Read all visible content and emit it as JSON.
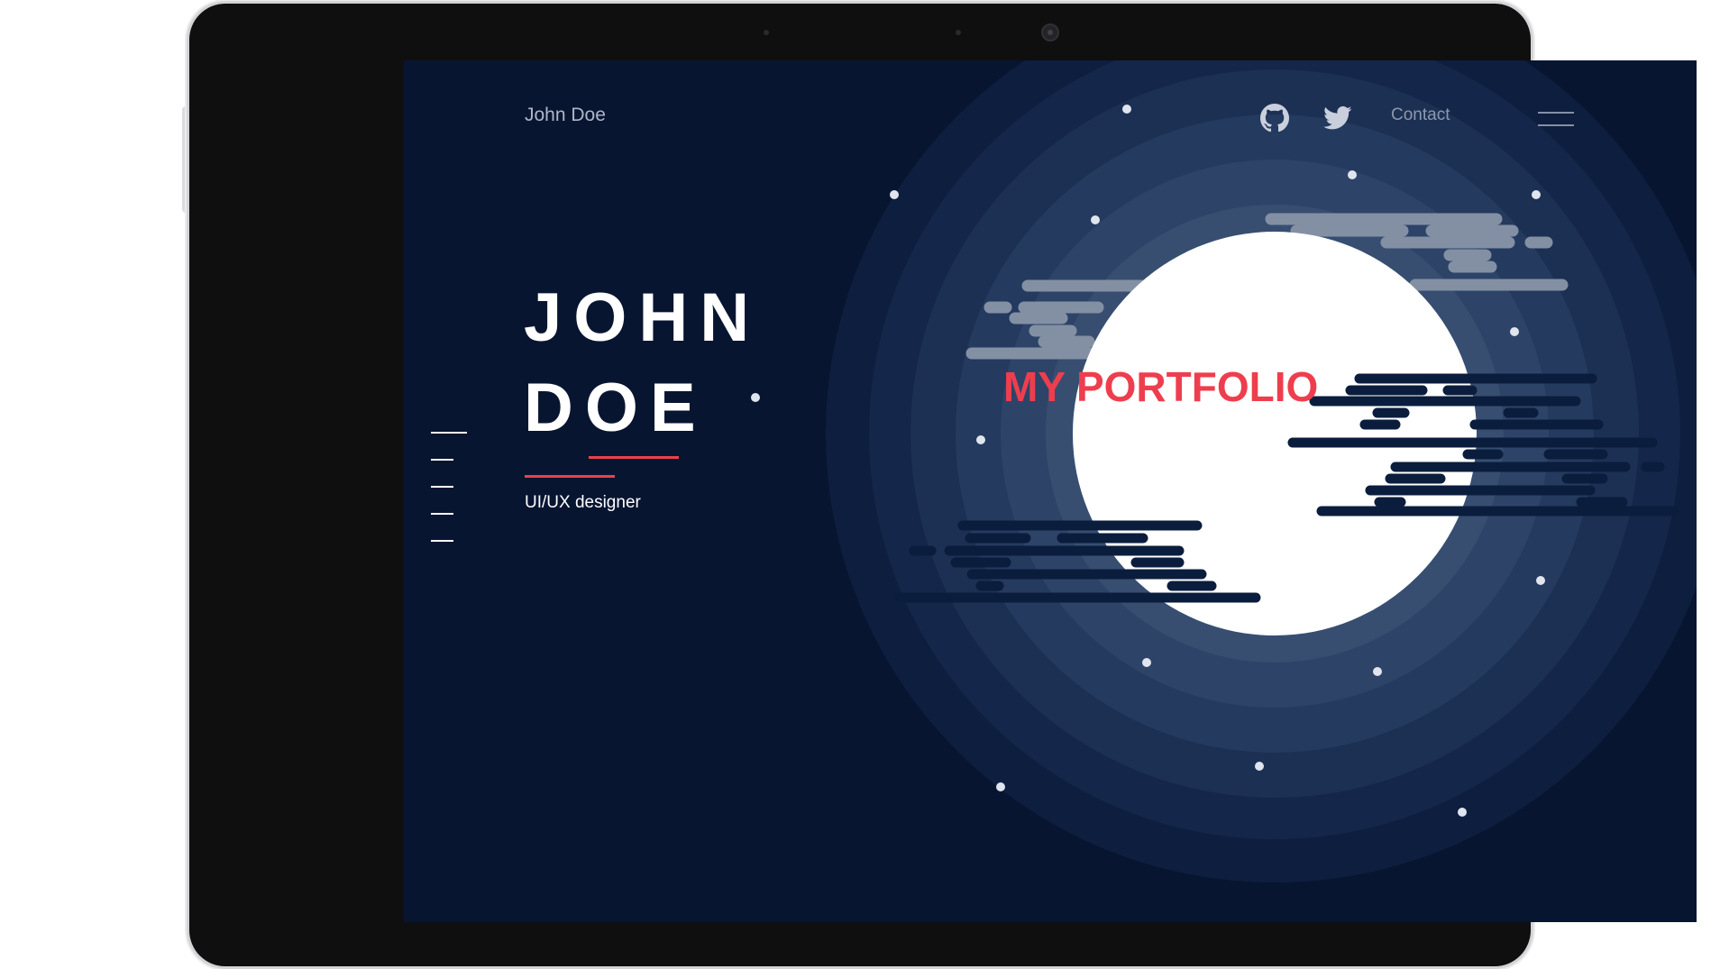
{
  "nav": {
    "name": "John Doe",
    "contact": "Contact",
    "icons": [
      "github-icon",
      "twitter-icon",
      "hamburger-menu-icon"
    ]
  },
  "hero": {
    "title_line1": "JOHN",
    "title_line2": "DOE",
    "subtitle": "UI/UX designer",
    "portfolio": "MY PORTFOLIO"
  },
  "colors": {
    "background": "#081530",
    "accent": "#e8424f",
    "portfolio_text": "#ee3e4e",
    "moon": "#ffffff",
    "cloud_light": "#8390a4",
    "cloud_dark": "#0b1d3d"
  }
}
